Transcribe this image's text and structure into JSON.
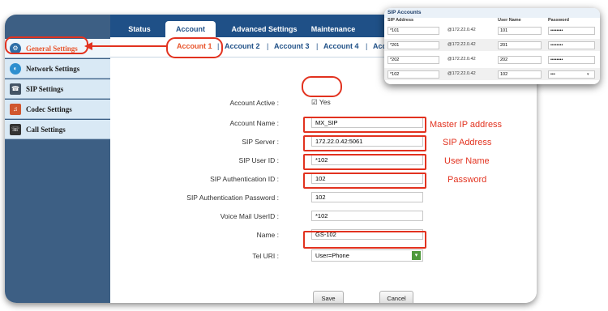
{
  "tabs": [
    "Status",
    "Account",
    "Advanced Settings",
    "Maintenance"
  ],
  "subtabs": [
    "Account 1",
    "Account 2",
    "Account 3",
    "Account 4",
    "Acc"
  ],
  "sidebar": [
    "General Settings",
    "Network Settings",
    "SIP Settings",
    "Codec Settings",
    "Call Settings"
  ],
  "form": {
    "account_active_label": "Account Active :",
    "account_active_value": "Yes",
    "account_name_label": "Account Name :",
    "account_name_value": "MX_SIP",
    "sip_server_label": "SIP Server :",
    "sip_server_value": "172.22.0.42:5061",
    "sip_user_id_label": "SIP User ID :",
    "sip_user_id_value": "*102",
    "sip_auth_id_label": "SIP Authentication ID :",
    "sip_auth_id_value": "102",
    "sip_auth_password_label": "SIP Authentication Password :",
    "sip_auth_password_value": "102",
    "voice_mail_label": "Voice Mail UserID :",
    "voice_mail_value": "*102",
    "name_label": "Name :",
    "name_value": "GS-102",
    "tel_uri_label": "Tel URI :",
    "tel_uri_value": "User=Phone",
    "save": "Save",
    "cancel": "Cancel"
  },
  "annotations": {
    "master_ip": "Master IP address",
    "sip_address": "SIP Address",
    "user_name": "User Name",
    "password": "Password"
  },
  "popup": {
    "title": "SIP Accounts",
    "headers": [
      "SIP Address",
      "User Name",
      "Password"
    ],
    "rows": [
      {
        "address": "*101",
        "domain": "@172.22.0.42",
        "user": "101",
        "password": "••••••••"
      },
      {
        "address": "*201",
        "domain": "@172.22.0.42",
        "user": "201",
        "password": "••••••••"
      },
      {
        "address": "*202",
        "domain": "@172.22.0.42",
        "user": "202",
        "password": "••••••••"
      },
      {
        "address": "*102",
        "domain": "@172.22.0.42",
        "user": "102",
        "password": "•••"
      }
    ]
  },
  "colors": {
    "accent": "#e8532a",
    "highlight": "#e2321f",
    "nav": "#1f5087",
    "sidebar": "#3d5f84"
  }
}
